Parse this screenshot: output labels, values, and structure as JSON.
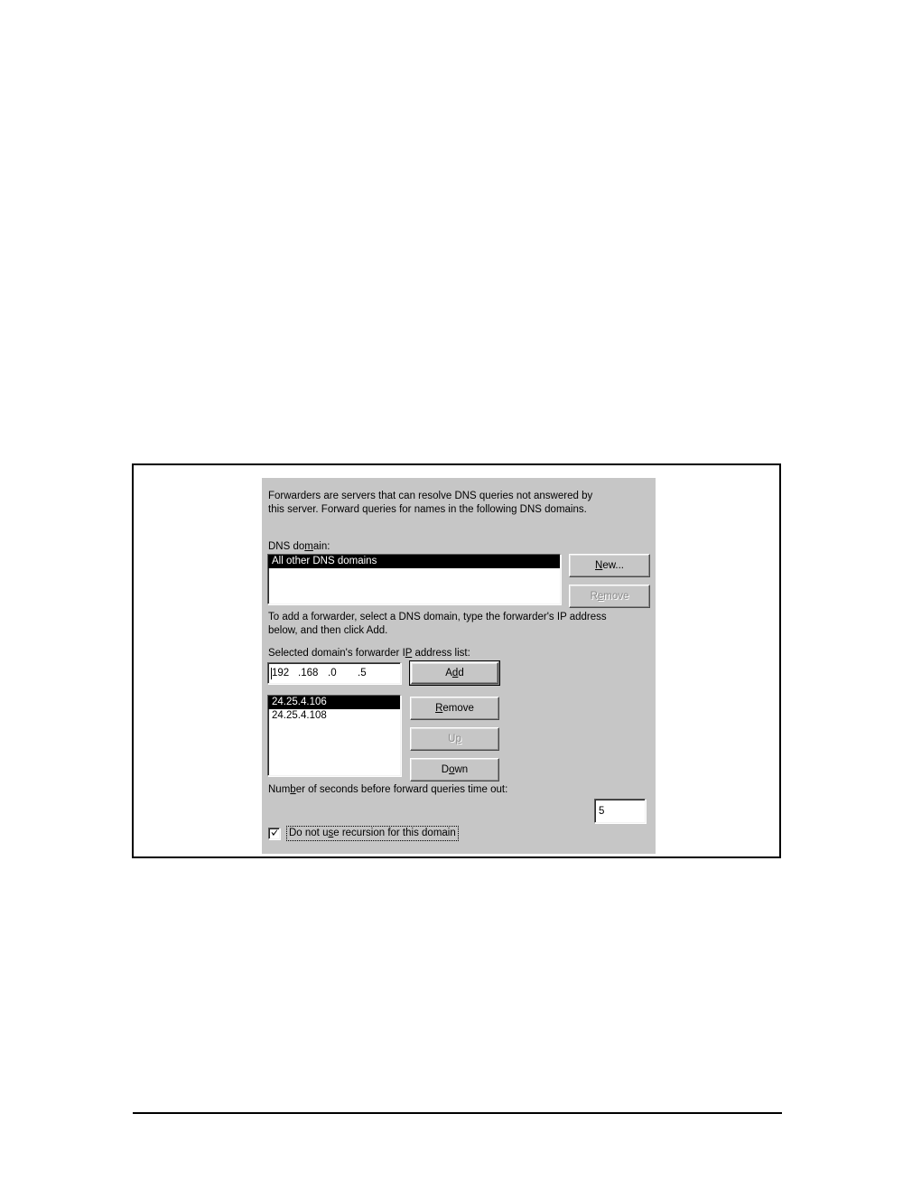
{
  "dialog": {
    "intro_text": "Forwarders are servers that can resolve DNS queries not answered by\nthis server. Forward queries for names in the following DNS domains.",
    "dns_domain_label": "DNS domain:",
    "dns_domain_label_pre": "DNS do",
    "dns_domain_label_accel": "m",
    "dns_domain_label_post": "ain:",
    "dns_domain_list": [
      {
        "text": "All other DNS domains",
        "selected": true
      }
    ],
    "new_button": {
      "pre": "",
      "accel": "N",
      "post": "ew...",
      "label": "New...",
      "enabled": true
    },
    "remove_domain_button": {
      "pre": "R",
      "accel": "e",
      "post": "move",
      "label": "Remove",
      "enabled": false
    },
    "instruction_text": "To add a forwarder, select a DNS domain, type the forwarder's IP address\nbelow, and then click Add.",
    "forwarder_list_label_pre": "Selected domain's forwarder I",
    "forwarder_list_label_accel": "P",
    "forwarder_list_label_post": " address list:",
    "forwarder_list_label": "Selected domain's forwarder IP address list:",
    "ip_input": {
      "value": "192.168.0.5",
      "octets": [
        "192",
        ".168",
        ".0",
        ".5"
      ]
    },
    "add_button": {
      "pre": "A",
      "accel": "d",
      "post": "d",
      "label": "Add",
      "enabled": true,
      "is_default": true
    },
    "forwarder_ip_list": [
      {
        "text": "24.25.4.106",
        "selected": true
      },
      {
        "text": "24.25.4.108",
        "selected": false
      }
    ],
    "remove_ip_button": {
      "pre": "",
      "accel": "R",
      "post": "emove",
      "label": "Remove",
      "enabled": true
    },
    "up_button": {
      "pre": "U",
      "accel": "p",
      "post": "",
      "label": "Up",
      "enabled": false
    },
    "down_button": {
      "pre": "D",
      "accel": "o",
      "post": "wn",
      "label": "Down",
      "enabled": true
    },
    "timeout_label_pre": "Num",
    "timeout_label_accel": "b",
    "timeout_label_post": "er of seconds before forward queries time out:",
    "timeout_label": "Number of seconds before forward queries time out:",
    "timeout_value": "5",
    "recursion_checkbox": {
      "checked": true,
      "pre": "Do not u",
      "accel": "s",
      "post": "e recursion for this domain",
      "label": "Do not use recursion for this domain"
    }
  },
  "colors": {
    "dialog_face": "#c6c6c6",
    "selection": "#000000",
    "selection_text": "#ffffff",
    "field_background": "#ffffff",
    "text": "#000000",
    "disabled_text": "#8a8a8a"
  }
}
